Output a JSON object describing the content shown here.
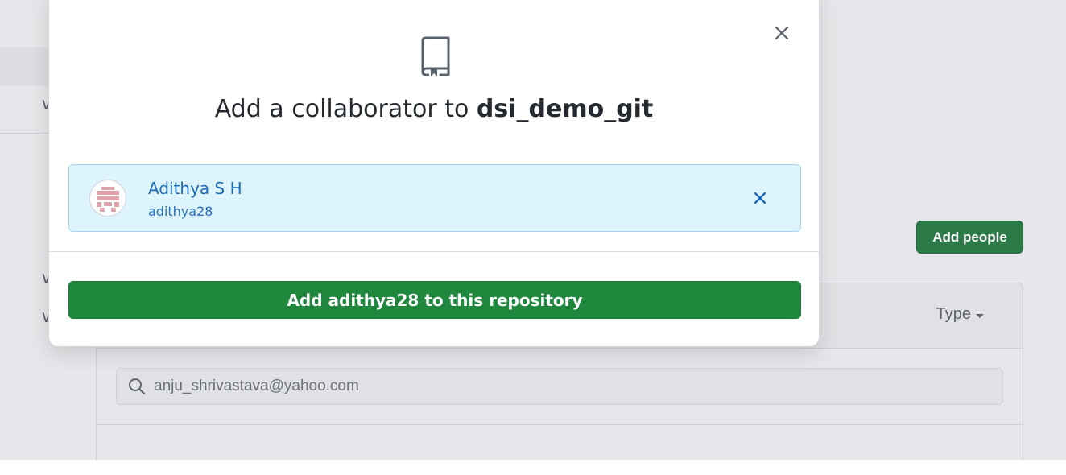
{
  "background": {
    "add_people_label": "Add people",
    "type_filter_label": "Type",
    "search_value": "anju_shrivastava@yahoo.com"
  },
  "modal": {
    "title_prefix": "Add a collaborator to ",
    "repo_name": "dsi_demo_git",
    "selected_user": {
      "display_name": "Adithya S H",
      "login": "adithya28"
    },
    "confirm_label": "Add adithya28 to this repository"
  },
  "colors": {
    "primary_green": "#1f883d",
    "selected_bg": "#ddf4ff",
    "link_blue": "#1a6cb7"
  },
  "icons": [
    "repo-icon",
    "close-icon",
    "remove-user-icon",
    "search-icon",
    "chevron-down-icon",
    "caret-down-icon"
  ]
}
